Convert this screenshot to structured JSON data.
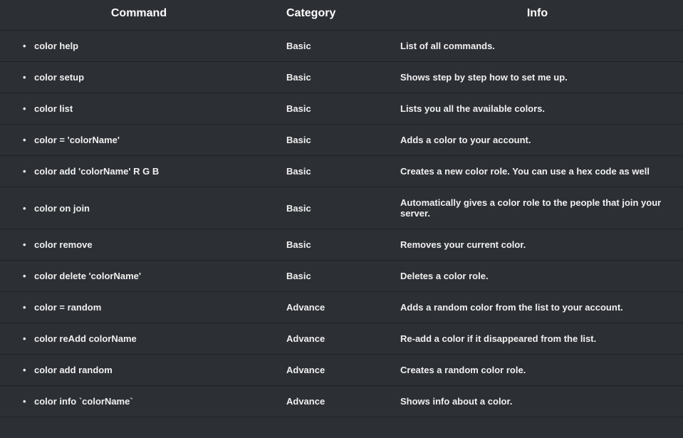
{
  "headers": {
    "command": "Command",
    "category": "Category",
    "info": "Info"
  },
  "rows": [
    {
      "command": "color help",
      "category": "Basic",
      "info": "List of all commands."
    },
    {
      "command": "color setup",
      "category": "Basic",
      "info": "Shows step by step how to set me up."
    },
    {
      "command": "color list",
      "category": "Basic",
      "info": "Lists you all the available colors."
    },
    {
      "command": "color = 'colorName'",
      "category": "Basic",
      "info": "Adds a color to your account."
    },
    {
      "command": "color add 'colorName' R G B",
      "category": "Basic",
      "info": "Creates a new color role. You can use a hex code as well"
    },
    {
      "command": "color on join",
      "category": "Basic",
      "info": "Automatically gives a color role to the people that join your server."
    },
    {
      "command": "color remove",
      "category": "Basic",
      "info": "Removes your current color."
    },
    {
      "command": "color delete 'colorName'",
      "category": "Basic",
      "info": "Deletes a color role."
    },
    {
      "command": "color = random",
      "category": "Advance",
      "info": "Adds a random color from the list to your account."
    },
    {
      "command": "color reAdd colorName",
      "category": "Advance",
      "info": "Re-add a color if it disappeared from the list."
    },
    {
      "command": "color add random",
      "category": "Advance",
      "info": "Creates a random color role."
    },
    {
      "command": "color info `colorName`",
      "category": "Advance",
      "info": "Shows info about a color."
    }
  ]
}
